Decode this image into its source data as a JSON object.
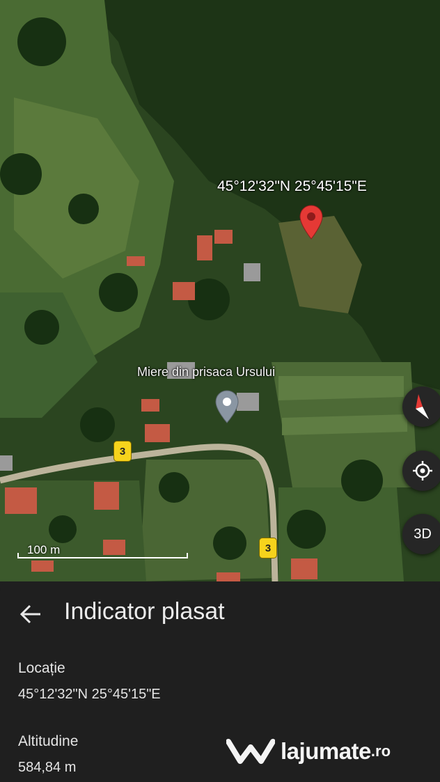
{
  "map": {
    "coordinate_label": "45°12'32\"N 25°45'15\"E",
    "place_label": "Miere din prisaca Ursului",
    "road_shields": [
      "3",
      "3"
    ],
    "scale_label": "100 m",
    "three_d_label": "3D",
    "icons": {
      "dropped_pin": "red-pin-icon",
      "place_pin": "place-pin-icon",
      "compass": "compass-icon",
      "my_location": "my-location-icon"
    },
    "colors": {
      "pin_red": "#e53935",
      "road_shield": "#f6d31c",
      "button_bg": "#262626"
    }
  },
  "sheet": {
    "title": "Indicator plasat",
    "location_label": "Locație",
    "location_value": "45°12'32\"N 25°45'15\"E",
    "altitude_label": "Altitudine",
    "altitude_value": "584,84 m",
    "back_icon": "back-arrow-icon"
  },
  "watermark": {
    "brand": "lajumate",
    "suffix": ".ro",
    "logo_icon": "lajumate-logo-icon"
  }
}
